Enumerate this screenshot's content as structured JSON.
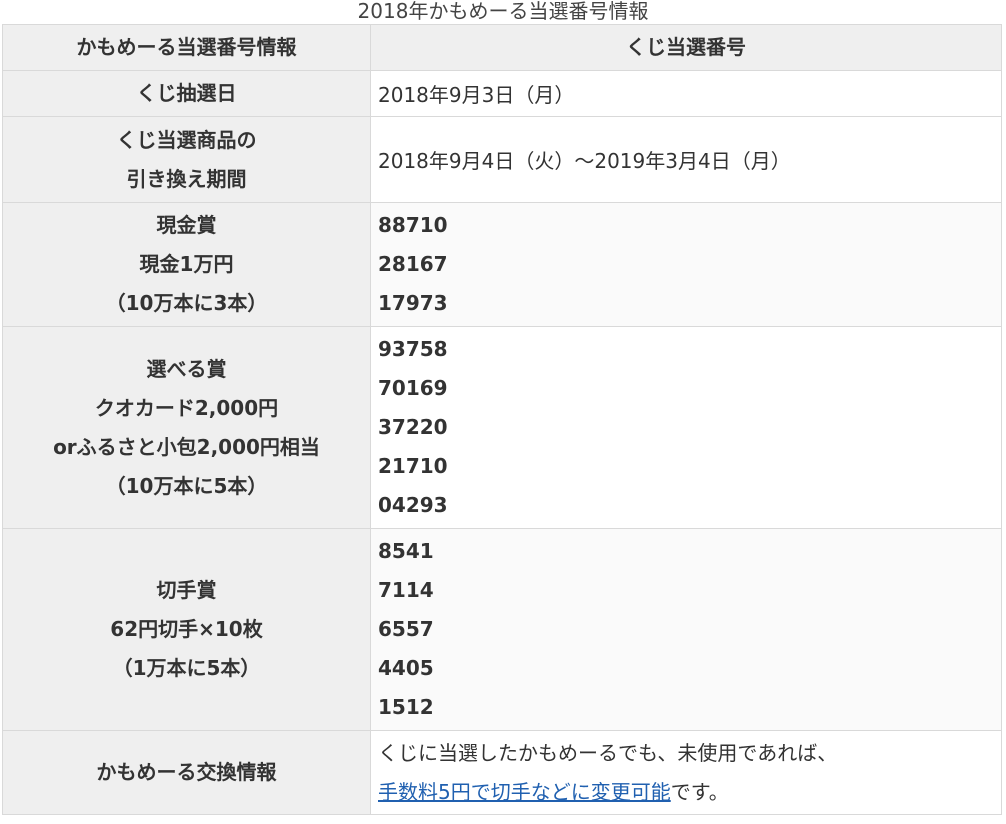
{
  "caption": "2018年かもめーる当選番号情報",
  "table": {
    "header": {
      "left": "かもめーる当選番号情報",
      "right": "くじ当選番号"
    },
    "draw_date": {
      "label": "くじ抽選日",
      "value": "2018年9月3日（月）"
    },
    "exchange_period": {
      "label_lines": [
        "くじ当選商品の",
        "引き換え期間"
      ],
      "value": "2018年9月4日（火）～2019年3月4日（月）"
    },
    "cash_prize": {
      "label_lines": [
        "現金賞",
        "現金1万円",
        "（10万本に3本）"
      ],
      "numbers": [
        "88710",
        "28167",
        "17973"
      ]
    },
    "choice_prize": {
      "label_lines": [
        "選べる賞",
        "クオカード2,000円",
        "orふるさと小包2,000円相当",
        "（10万本に5本）"
      ],
      "numbers": [
        "93758",
        "70169",
        "37220",
        "21710",
        "04293"
      ]
    },
    "stamp_prize": {
      "label_lines": [
        "切手賞",
        "62円切手×10枚",
        "（1万本に5本）"
      ],
      "numbers": [
        "8541",
        "7114",
        "6557",
        "4405",
        "1512"
      ]
    },
    "exchange_info": {
      "label": "かもめーる交換情報",
      "line1": "くじに当選したかもめーるでも、未使用であれば、",
      "link_text": "手数料5円で切手などに変更可能",
      "suffix": "です。"
    }
  }
}
